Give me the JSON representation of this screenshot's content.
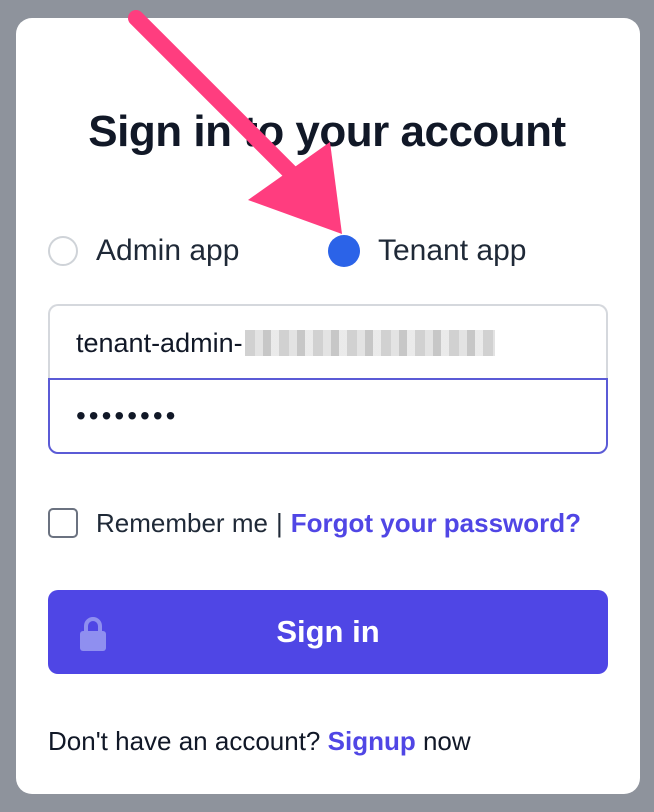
{
  "heading": "Sign in to your account",
  "app_choice": {
    "options": [
      {
        "label": "Admin app",
        "selected": false
      },
      {
        "label": "Tenant app",
        "selected": true
      }
    ]
  },
  "form": {
    "username_value": "tenant-admin-",
    "password_value": "••••••••",
    "remember_label": "Remember me",
    "separator": "|",
    "forgot_label": "Forgot your password?",
    "signin_label": "Sign in"
  },
  "footer": {
    "prefix": "Don't have an account?",
    "signup_label": "Signup",
    "suffix": "now"
  },
  "colors": {
    "accent": "#4f46e5",
    "radio_selected": "#2b63e8",
    "annotation_arrow": "#ff3d7f"
  }
}
